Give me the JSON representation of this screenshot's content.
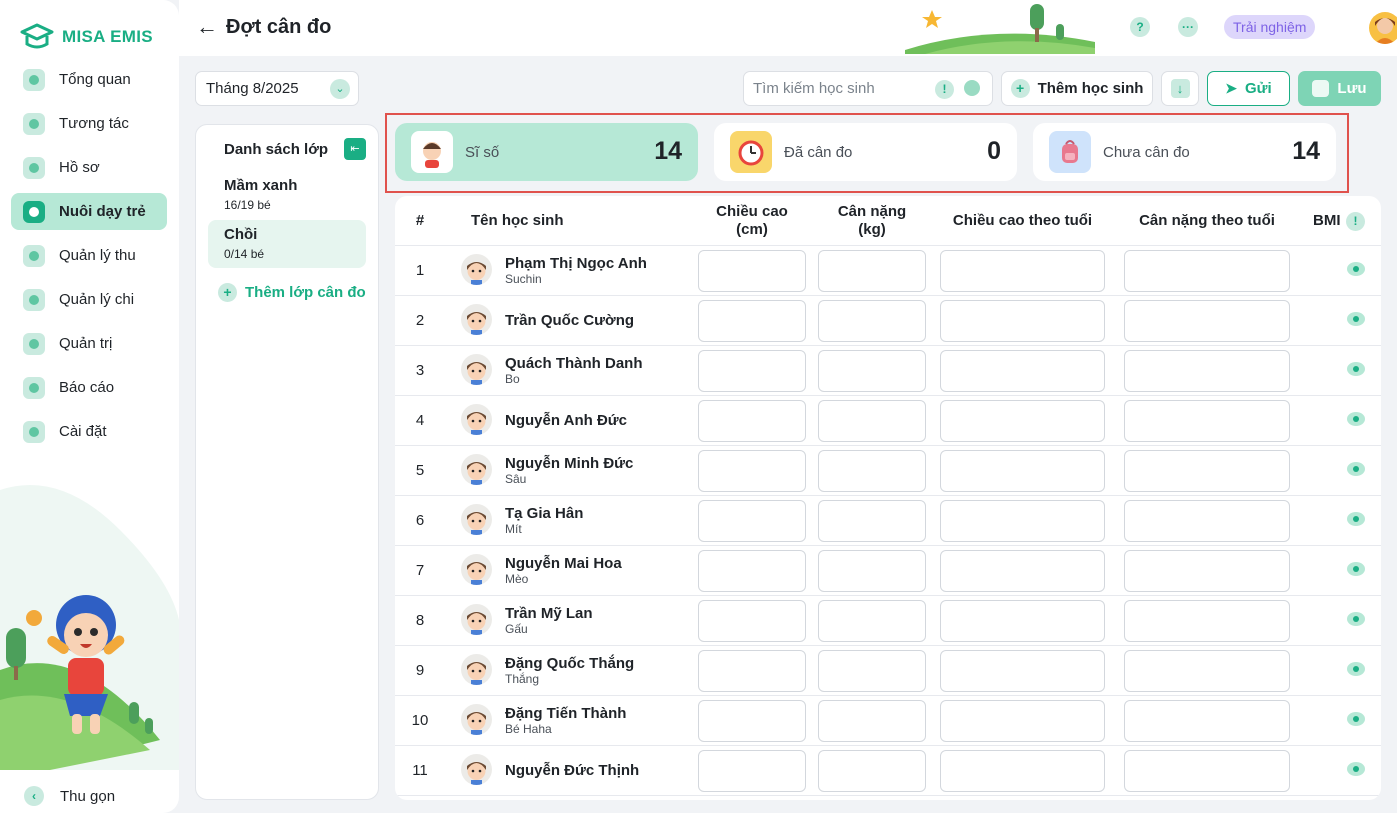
{
  "app": {
    "logo_text": "MISA EMIS"
  },
  "sidebar": {
    "items": [
      {
        "label": "Tổng quan",
        "icon": "pie-chart-icon",
        "active": false
      },
      {
        "label": "Tương tác",
        "icon": "paper-plane-icon",
        "active": false
      },
      {
        "label": "Hồ sơ",
        "icon": "folder-icon",
        "active": false
      },
      {
        "label": "Nuôi dạy trẻ",
        "icon": "heart-shield-icon",
        "active": true
      },
      {
        "label": "Quản lý thu",
        "icon": "trend-up-icon",
        "active": false
      },
      {
        "label": "Quản lý chi",
        "icon": "wallet-icon",
        "active": false
      },
      {
        "label": "Quản trị",
        "icon": "briefcase-icon",
        "active": false
      },
      {
        "label": "Báo cáo",
        "icon": "bar-chart-icon",
        "active": false
      },
      {
        "label": "Cài đặt",
        "icon": "gear-icon",
        "active": false
      }
    ],
    "collapse_label": "Thu gọn"
  },
  "header": {
    "title": "Đợt cân đo",
    "trial_label": "Trải nghiệm"
  },
  "toolbar": {
    "month_value": "Tháng 8/2025",
    "search_placeholder": "Tìm kiếm học sinh",
    "add_student_label": "Thêm học sinh",
    "send_label": "Gửi",
    "save_label": "Lưu"
  },
  "class_panel": {
    "title": "Danh sách lớp",
    "classes": [
      {
        "name": "Mầm xanh",
        "count": "16/19 bé"
      },
      {
        "name": "Chồi",
        "count": "0/14 bé",
        "selected": true
      }
    ],
    "add_label": "Thêm lớp cân đo"
  },
  "stats": [
    {
      "label": "Sĩ số",
      "value": "14"
    },
    {
      "label": "Đã cân đo",
      "value": "0"
    },
    {
      "label": "Chưa cân đo",
      "value": "14"
    }
  ],
  "table": {
    "headers": {
      "index": "#",
      "name": "Tên học sinh",
      "height_a": "Chiều cao",
      "height_b": "(cm)",
      "weight_a": "Cân nặng",
      "weight_b": "(kg)",
      "height_age": "Chiều cao theo tuổi",
      "weight_age": "Cân nặng theo tuổi",
      "bmi": "BMI"
    },
    "rows": [
      {
        "index": "1",
        "name": "Phạm Thị Ngọc Anh",
        "nickname": "Suchin"
      },
      {
        "index": "2",
        "name": "Trần Quốc Cường",
        "nickname": ""
      },
      {
        "index": "3",
        "name": "Quách Thành Danh",
        "nickname": "Bo"
      },
      {
        "index": "4",
        "name": "Nguyễn Anh Đức",
        "nickname": ""
      },
      {
        "index": "5",
        "name": "Nguyễn Minh Đức",
        "nickname": "Sâu"
      },
      {
        "index": "6",
        "name": "Tạ Gia Hân",
        "nickname": "Mít"
      },
      {
        "index": "7",
        "name": "Nguyễn Mai Hoa",
        "nickname": "Mèo"
      },
      {
        "index": "8",
        "name": "Trần Mỹ Lan",
        "nickname": "Gấu"
      },
      {
        "index": "9",
        "name": "Đặng Quốc Thắng",
        "nickname": "Thắng"
      },
      {
        "index": "10",
        "name": "Đặng Tiến Thành",
        "nickname": "Bé Haha"
      },
      {
        "index": "11",
        "name": "Nguyễn Đức Thịnh",
        "nickname": ""
      }
    ]
  },
  "colors": {
    "brand": "#1aae84",
    "active_bg": "#b6e8d6",
    "highlight": "#e0524d"
  }
}
